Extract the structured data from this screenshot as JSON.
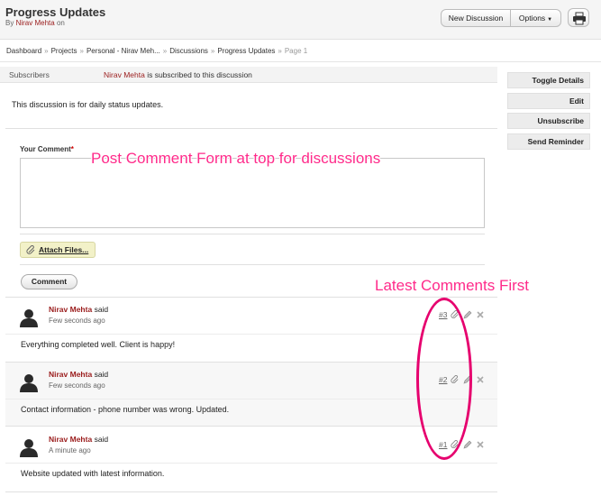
{
  "header": {
    "title": "Progress Updates",
    "byline_prefix": "By",
    "author": "Nirav Mehta",
    "byline_suffix": "on",
    "new_discussion_label": "New Discussion",
    "options_label": "Options"
  },
  "breadcrumb": {
    "items": [
      "Dashboard",
      "Projects",
      "Personal - Nirav Meh...",
      "Discussions",
      "Progress Updates"
    ],
    "separator": "»",
    "current": "Page 1"
  },
  "subscribers": {
    "label": "Subscribers",
    "name": "Nirav Mehta",
    "text": "is subscribed to this discussion"
  },
  "sidebar": {
    "buttons": [
      "Toggle Details",
      "Edit",
      "Unsubscribe",
      "Send Reminder"
    ]
  },
  "description": "This discussion is for daily status updates.",
  "form": {
    "label": "Your Comment",
    "required_mark": "*",
    "attach_label": "Attach Files...",
    "comment_button": "Comment"
  },
  "comments": [
    {
      "author": "Nirav Mehta",
      "said": "said",
      "time": "Few seconds ago",
      "number": "#3",
      "body": "Everything completed well. Client is happy!"
    },
    {
      "author": "Nirav Mehta",
      "said": "said",
      "time": "Few seconds ago",
      "number": "#2",
      "body": "Contact information - phone number was wrong. Updated."
    },
    {
      "author": "Nirav Mehta",
      "said": "said",
      "time": "A minute ago",
      "number": "#1",
      "body": "Website updated with latest information."
    }
  ],
  "annotations": {
    "form_note": "Post Comment Form at top for discussions",
    "order_note": "Latest Comments First"
  },
  "icons": [
    "print-icon",
    "paperclip-icon",
    "user-avatar-icon",
    "edit-icon",
    "delete-icon"
  ],
  "colors": {
    "author_red": "#9a1b1b",
    "annotation_pink": "#ff2a8a",
    "highlight_oval": "#e6006e",
    "attach_bg": "#f2f1c8"
  }
}
